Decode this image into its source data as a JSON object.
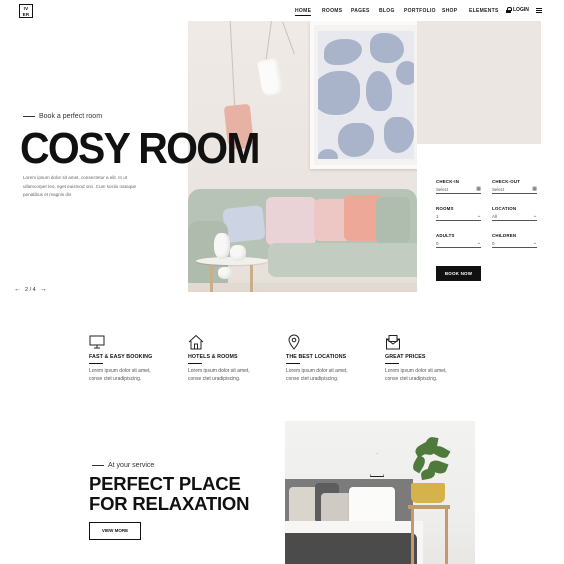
{
  "header": {
    "logo_top": "IV",
    "logo_bottom": "ER",
    "nav": [
      {
        "label": "HOME",
        "active": true
      },
      {
        "label": "ROOMS",
        "active": false
      },
      {
        "label": "PAGES",
        "active": false
      },
      {
        "label": "BLOG",
        "active": false
      },
      {
        "label": "PORTFOLIO",
        "active": false
      },
      {
        "label": "SHOP",
        "active": false
      },
      {
        "label": "ELEMENTS",
        "active": false
      }
    ],
    "login": "LOGIN"
  },
  "hero": {
    "eyebrow": "Book a perfect room",
    "title": "COSY ROOM",
    "description": "Lorem ipsum dolor sit amet, consectetur a elit. In ut ullamcorper leo, eget euismod orci. Cum sociis natoque penatibus et magnis dis",
    "slide_counter": "2 / 4"
  },
  "booking": {
    "check_in": {
      "label": "CHECK-IN",
      "value": "Select"
    },
    "check_out": {
      "label": "CHECK-OUT",
      "value": "Select"
    },
    "rooms": {
      "label": "ROOMS",
      "value": "1"
    },
    "location": {
      "label": "LOCATION",
      "value": "All"
    },
    "adults": {
      "label": "ADULTS",
      "value": "0"
    },
    "children": {
      "label": "CHILDREN",
      "value": "0"
    },
    "button": "BOOK NOW"
  },
  "features": [
    {
      "icon": "monitor-icon",
      "title": "FAST & EASY BOOKING",
      "desc": "Lorem ipsum dolor sit amet, conse ctet uradipiscing."
    },
    {
      "icon": "home-icon",
      "title": "HOTELS & ROOMS",
      "desc": "Lorem ipsum dolor sit amet, conse ctet uradipiscing."
    },
    {
      "icon": "location-pin-icon",
      "title": "THE BEST LOCATIONS",
      "desc": "Lorem ipsum dolor sit amet, conse ctet uradipiscing."
    },
    {
      "icon": "envelope-icon",
      "title": "GREAT PRICES",
      "desc": "Lorem ipsum dolor sit amet, conse ctet uradipiscing."
    }
  ],
  "service": {
    "eyebrow": "At your service",
    "title_line1": "PERFECT PLACE",
    "title_line2": "FOR RELAXATION",
    "button": "VIEW MORE"
  },
  "colors": {
    "accent": "#111111",
    "sofa": "#b8c3b7",
    "art_blob": "#a9b4cb",
    "lamp_pink": "#e7b2a3",
    "basket": "#d6b34a"
  }
}
